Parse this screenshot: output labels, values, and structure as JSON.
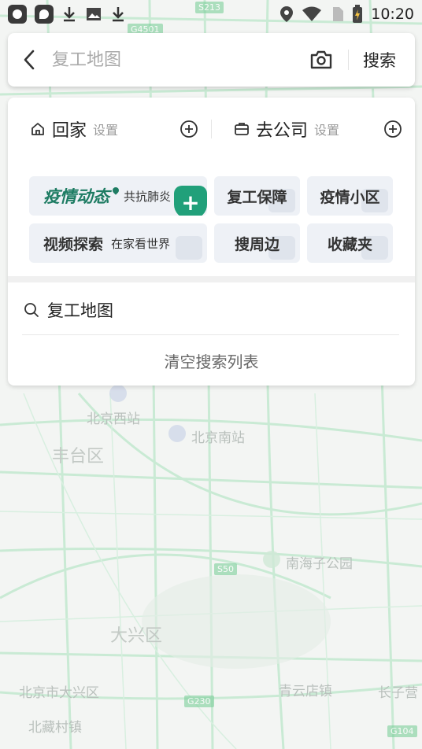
{
  "status_bar": {
    "time": "10:20",
    "notifications": [
      "du-app-icon",
      "du-map-icon",
      "download-icon",
      "image-icon",
      "download-icon"
    ],
    "indicators": [
      "location-icon",
      "wifi-icon",
      "no-sim-icon",
      "battery-charging-icon"
    ]
  },
  "search": {
    "placeholder": "复工地图",
    "search_label": "搜索"
  },
  "quick_access": [
    {
      "label": "回家",
      "sub": "设置"
    },
    {
      "label": "去公司",
      "sub": "设置"
    }
  ],
  "tiles": {
    "epidemic": {
      "label": "疫情动态",
      "sub": "共抗肺炎"
    },
    "resume": {
      "label": "复工保障"
    },
    "community": {
      "label": "疫情小区"
    },
    "video": {
      "label": "视频探索",
      "sub": "在家看世界"
    },
    "nearby": {
      "label": "搜周边"
    },
    "favorites": {
      "label": "收藏夹"
    }
  },
  "history": {
    "items": [
      {
        "text": "复工地图"
      }
    ],
    "clear_label": "清空搜索列表"
  },
  "map": {
    "labels": [
      "北京西站",
      "北京南站",
      "丰台区",
      "南海子公园",
      "大兴区",
      "青云店镇",
      "北京市大兴区",
      "北藏村镇",
      "长子营"
    ],
    "road_shields": [
      "S213",
      "G4501",
      "S50",
      "G230",
      "G104"
    ],
    "colors": {
      "road": "#8fd9a8",
      "accent": "#1e7c63",
      "tile_bg": "#eef1f6"
    }
  }
}
